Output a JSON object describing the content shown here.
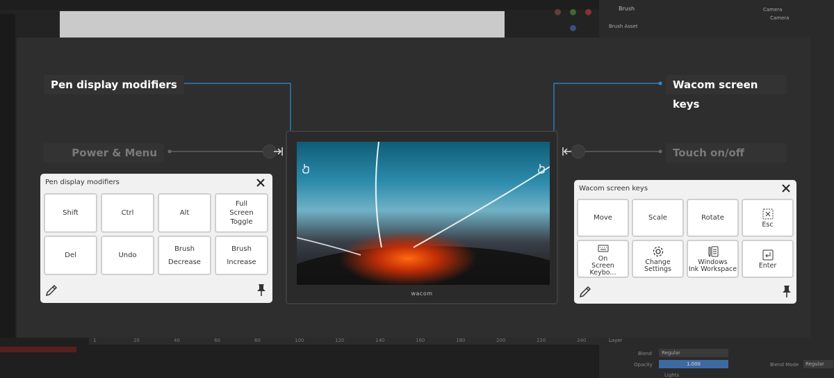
{
  "background": {
    "panel_label_brush": "Brush",
    "panel_label_brush_asset": "Brush Asset",
    "outliner_camera_group": "Camera",
    "outliner_camera": "Camera",
    "blend_label": "Blend",
    "blend_value": "Regular",
    "opacity_label": "Opacity",
    "opacity_value": "1.000",
    "lights_label": "Lights",
    "blend_mode_label": "Blend Mode",
    "blend_mode_value": "Regular",
    "layer_label": "Layer",
    "timeline_ticks": [
      "1",
      "20",
      "40",
      "60",
      "80",
      "100",
      "120",
      "140",
      "160",
      "180",
      "200",
      "220",
      "240"
    ]
  },
  "callouts": {
    "pen_modifiers": "Pen display modifiers",
    "power_menu": "Power & Menu",
    "screen_keys": "Wacom screen keys",
    "touch": "Touch on/off"
  },
  "device": {
    "brand": "wacom"
  },
  "left_panel": {
    "title": "Pen display modifiers",
    "keys": [
      "Shift",
      "Ctrl",
      "Alt",
      "Full\nScreen\nToggle",
      "Del",
      "Undo",
      "Brush\nDecrease",
      "Brush\nIncrease"
    ]
  },
  "right_panel": {
    "title": "Wacom screen keys",
    "keys": [
      "Move",
      "Scale",
      "Rotate",
      "Esc"
    ],
    "keys2": [
      {
        "label": "On\nScreen Keybo...",
        "icon": "keyboard-icon"
      },
      {
        "label": "Change\nSettings",
        "icon": "gear-icon"
      },
      {
        "label": "Windows\nInk Workspace",
        "icon": "ink-workspace-icon"
      },
      {
        "label": "Enter",
        "icon": "enter-icon"
      }
    ]
  },
  "colors": {
    "accent_line": "#2a8fe0",
    "panel_bg": "#f1f1f1",
    "overlay_bg": "#2e2e2e"
  }
}
